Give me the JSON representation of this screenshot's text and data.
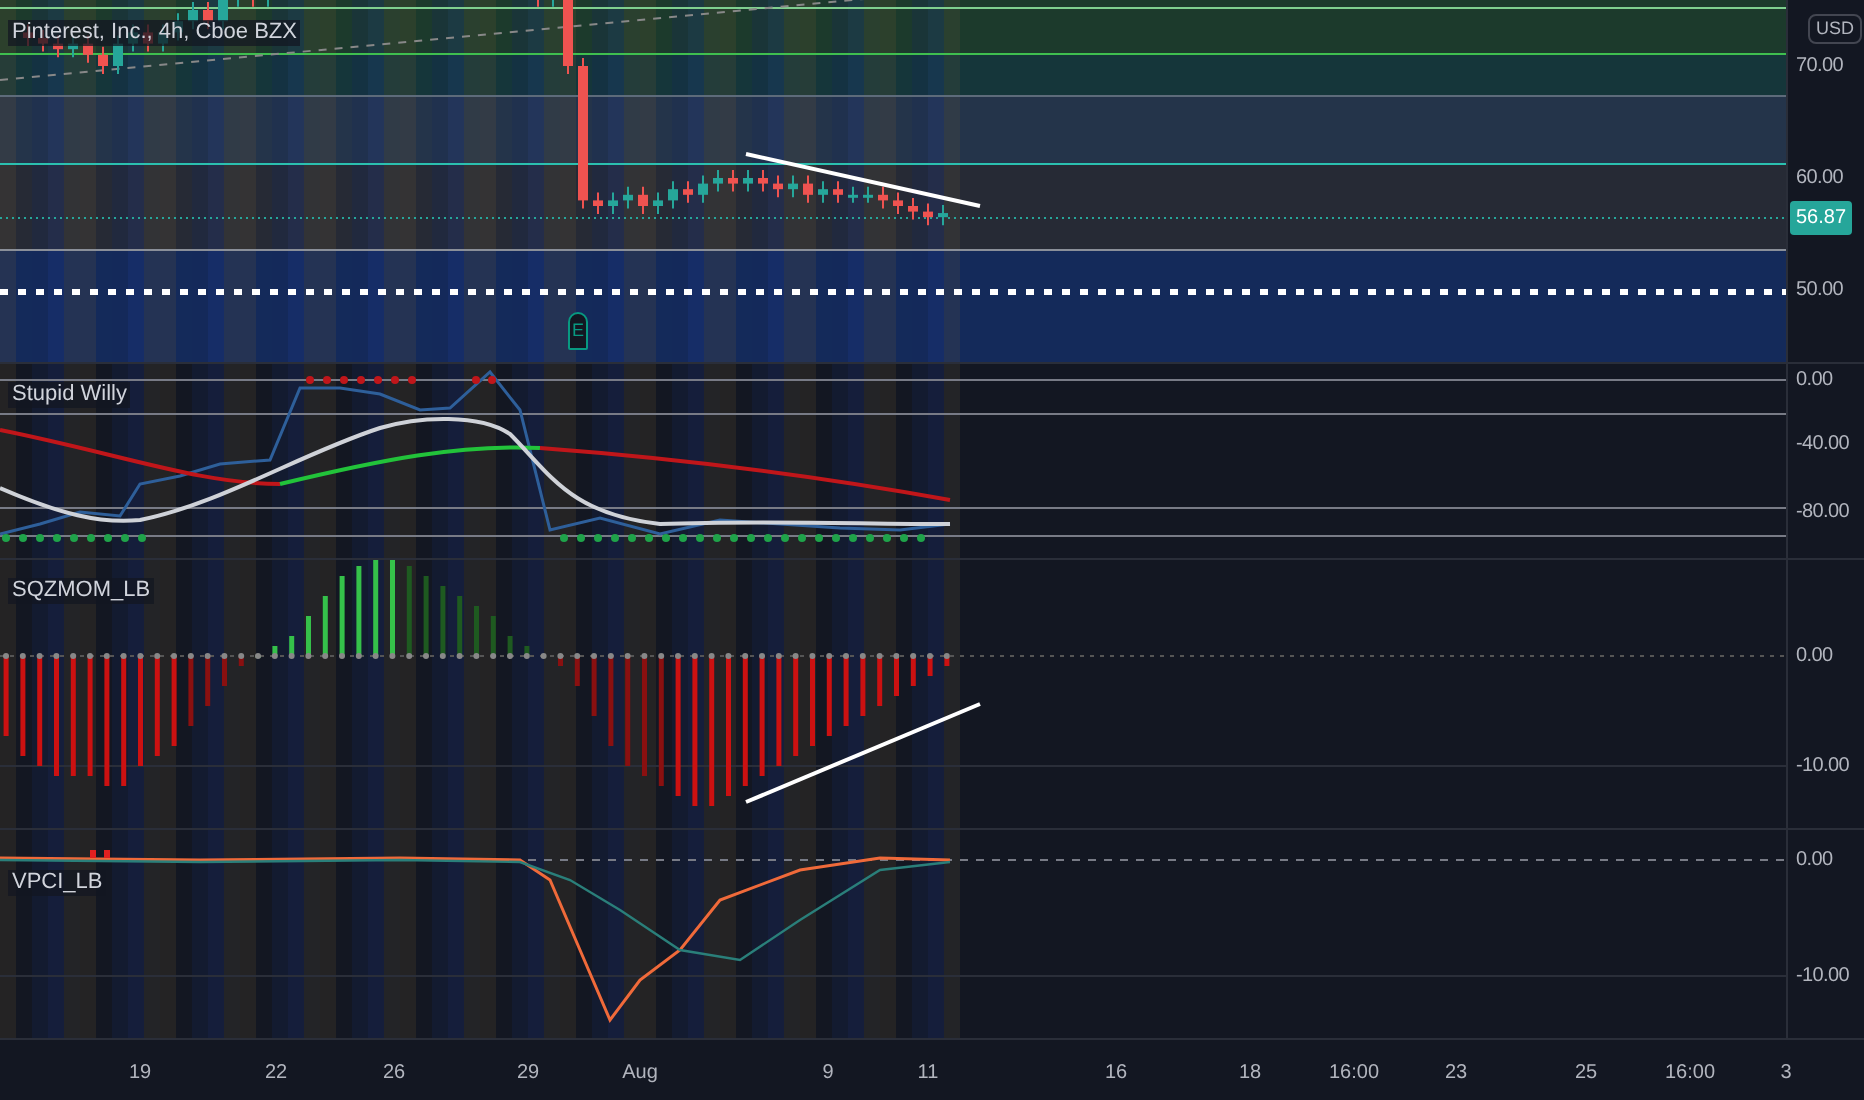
{
  "chart": {
    "title": "Pinterest, Inc., 4h, Cboe BZX",
    "currency": "USD",
    "price_ticks": [
      "70.00",
      "60.00",
      "50.00"
    ],
    "last_price": "56.87",
    "earnings_marker": "E"
  },
  "indicators": [
    {
      "name": "Stupid Willy",
      "ticks": [
        "0.00",
        "-40.00",
        "-80.00"
      ]
    },
    {
      "name": "SQZMOM_LB",
      "ticks": [
        "0.00",
        "-10.00"
      ]
    },
    {
      "name": "VPCI_LB",
      "ticks": [
        "0.00",
        "-10.00"
      ]
    }
  ],
  "time_axis": [
    "19",
    "22",
    "26",
    "29",
    "Aug",
    "9",
    "11",
    "16",
    "18",
    "16:00",
    "23",
    "25",
    "16:00",
    "3"
  ]
}
